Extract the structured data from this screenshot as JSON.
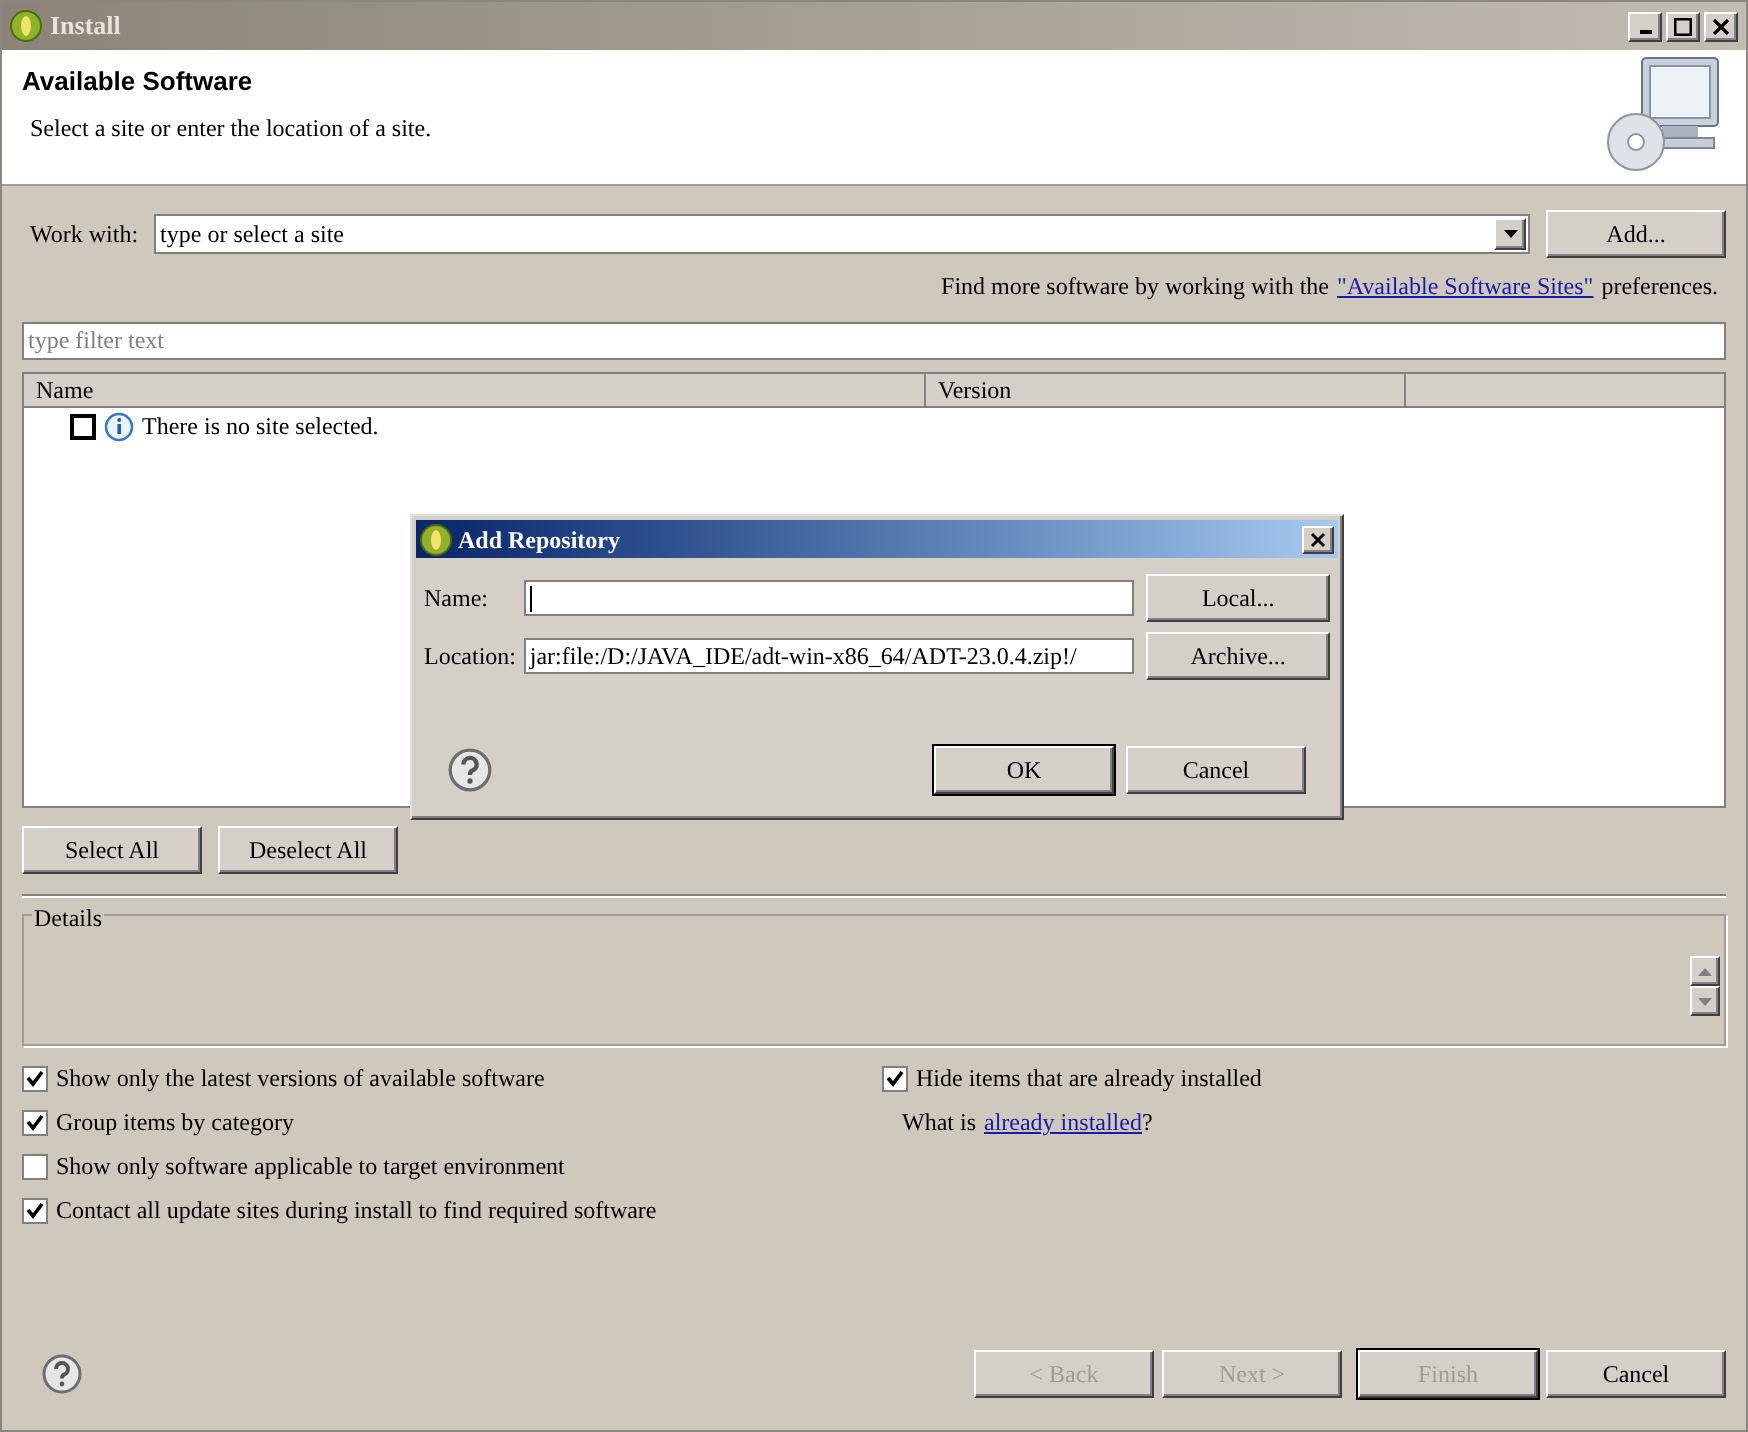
{
  "window": {
    "title": "Install"
  },
  "header": {
    "title": "Available Software",
    "description": "Select a site or enter the location of a site."
  },
  "work_with": {
    "label": "Work with:",
    "placeholder": "type or select a site",
    "button": "Add..."
  },
  "hint": {
    "prefix": "Find more software by working with the",
    "link": "\"Available Software Sites\"",
    "suffix": "preferences."
  },
  "filter": {
    "placeholder": "type filter text"
  },
  "table": {
    "columns": [
      "Name",
      "Version"
    ],
    "rows": [
      {
        "text": "There is no site selected.",
        "checked": false
      }
    ]
  },
  "selection_buttons": [
    "Select All",
    "Deselect All"
  ],
  "details": {
    "label": "Details"
  },
  "options_left": [
    {
      "label": "Show only the latest versions of available software",
      "checked": true
    },
    {
      "label": "Group items by category",
      "checked": true
    },
    {
      "label": "Show only software applicable to target environment",
      "checked": false
    },
    {
      "label": "Contact all update sites during install to find required software",
      "checked": true
    }
  ],
  "options_right": [
    {
      "label": "Hide items that are already installed",
      "checked": true
    }
  ],
  "installed_hint": {
    "prefix": "What is",
    "link": "already installed",
    "suffix": "?"
  },
  "footer_buttons": [
    {
      "label": "< Back",
      "disabled": true,
      "default": false
    },
    {
      "label": "Next >",
      "disabled": true,
      "default": false
    },
    {
      "label": "Finish",
      "disabled": true,
      "default": true
    },
    {
      "label": "Cancel",
      "disabled": false,
      "default": false
    }
  ],
  "dialog": {
    "title": "Add Repository",
    "fields": [
      {
        "label": "Name:",
        "button": "Local...",
        "focused": true
      },
      {
        "label": "Location:",
        "value": "jar:file:/D:/JAVA_IDE/adt-win-x86_64/ADT-23.0.4.zip!/",
        "button": "Archive...",
        "focused": false
      }
    ],
    "buttons": [
      {
        "label": "OK",
        "default": true
      },
      {
        "label": "Cancel",
        "default": false
      }
    ]
  }
}
